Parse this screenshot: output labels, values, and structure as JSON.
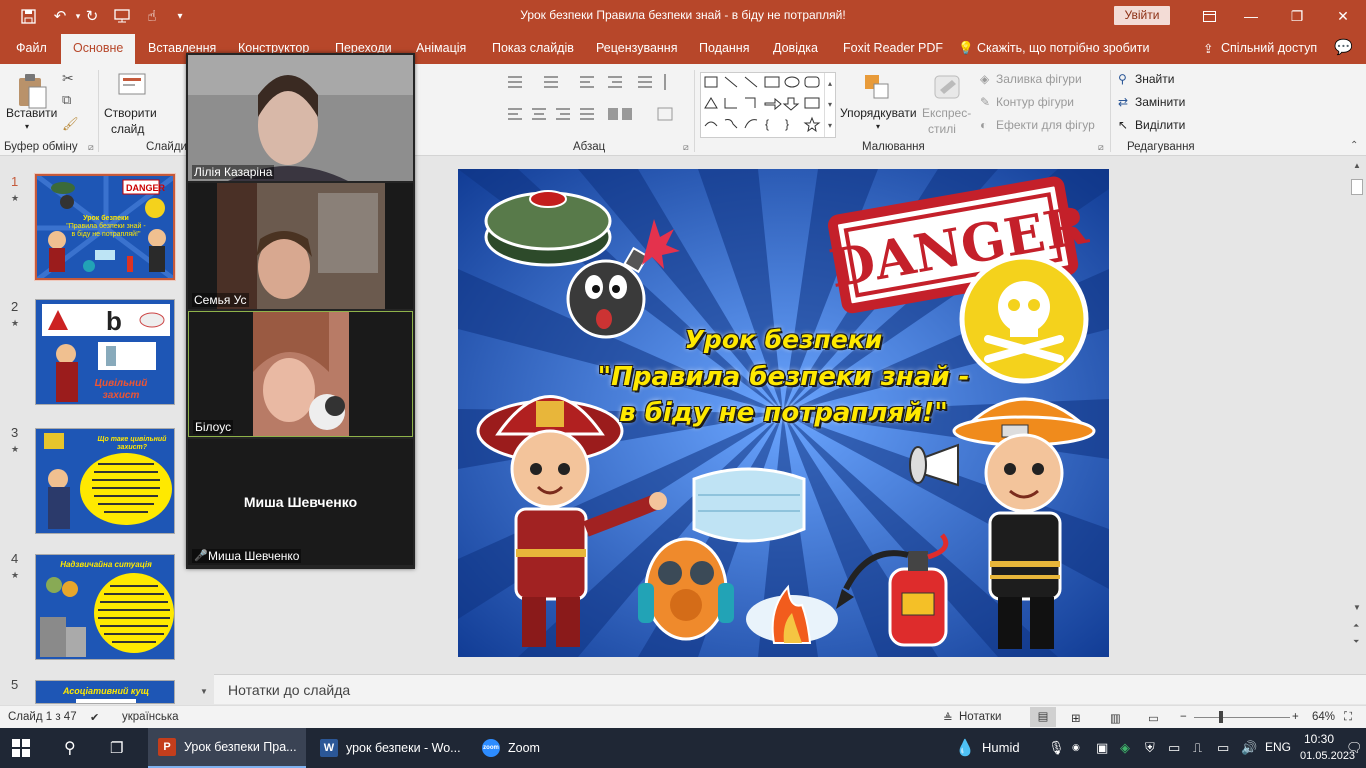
{
  "window": {
    "title": "Урок безпеки Правила безпеки знай - в біду не потрапляй!",
    "signin_label": "Увійти"
  },
  "tabs": [
    "Файл",
    "Основне",
    "Вставлення",
    "Конструктор",
    "Переходи",
    "Анімація",
    "Показ слайдів",
    "Рецензування",
    "Подання",
    "Довідка",
    "Foxit Reader PDF"
  ],
  "tell_me": "Скажіть, що потрібно зробити",
  "share_label": "Спільний доступ",
  "ribbon": {
    "clipboard": {
      "paste": "Вставити",
      "label": "Буфер обміну"
    },
    "slides": {
      "new_slide_1": "Створити",
      "new_slide_2": "слайд",
      "label": "Слайди"
    },
    "paragraph": {
      "label": "Абзац"
    },
    "drawing": {
      "arrange": "Упорядкувати",
      "quick_styles_1": "Експрес-",
      "quick_styles_2": "стилі",
      "fill": "Заливка фігури",
      "outline": "Контур фігури",
      "effects": "Ефекти для фігур",
      "label": "Малювання"
    },
    "editing": {
      "find": "Знайти",
      "replace": "Замінити",
      "select": "Виділити",
      "label": "Редагування"
    }
  },
  "thumbnails": [
    {
      "num": "1",
      "caption": ""
    },
    {
      "num": "2",
      "caption": "Цивільний захист"
    },
    {
      "num": "3",
      "caption": "Що таке цивільний захист?"
    },
    {
      "num": "4",
      "caption": "Надзвичайна ситуація"
    },
    {
      "num": "5",
      "caption": "Асоціативний кущ"
    }
  ],
  "zoom": {
    "participants": [
      {
        "name": "Лілія Казаріна"
      },
      {
        "name": "Семья Ус"
      },
      {
        "name": "Білоус"
      },
      {
        "name": "Миша Шевченко",
        "center_name": "Миша Шевченко"
      }
    ]
  },
  "slide": {
    "danger_stamp": "DANGER",
    "title_line1": "Урок безпеки",
    "title_line2": "\"Правила безпеки знай -",
    "title_line3": "в біду не потрапляй!\""
  },
  "notes_placeholder": "Нотатки до слайда",
  "status": {
    "slide_counter": "Слайд 1 з 47",
    "language": "українська",
    "notes_button": "Нотатки",
    "zoom_level": "64%"
  },
  "taskbar": {
    "apps": [
      {
        "label": "Урок безпеки Пра...",
        "badge": "P",
        "color": "#c43e1c"
      },
      {
        "label": "урок безпеки - Wo...",
        "badge": "W",
        "color": "#2b5797"
      },
      {
        "label": "Zoom",
        "badge": "zoom",
        "color": "#2d8cff"
      }
    ],
    "weather": "Humid",
    "lang": "ENG",
    "time": "10:30",
    "date": "01.05.2023"
  },
  "colors": {
    "accent": "#b7472a",
    "slide_bg": "#1b4aa7",
    "title_yellow": "#ffe900",
    "taskbar": "#1f2735"
  }
}
